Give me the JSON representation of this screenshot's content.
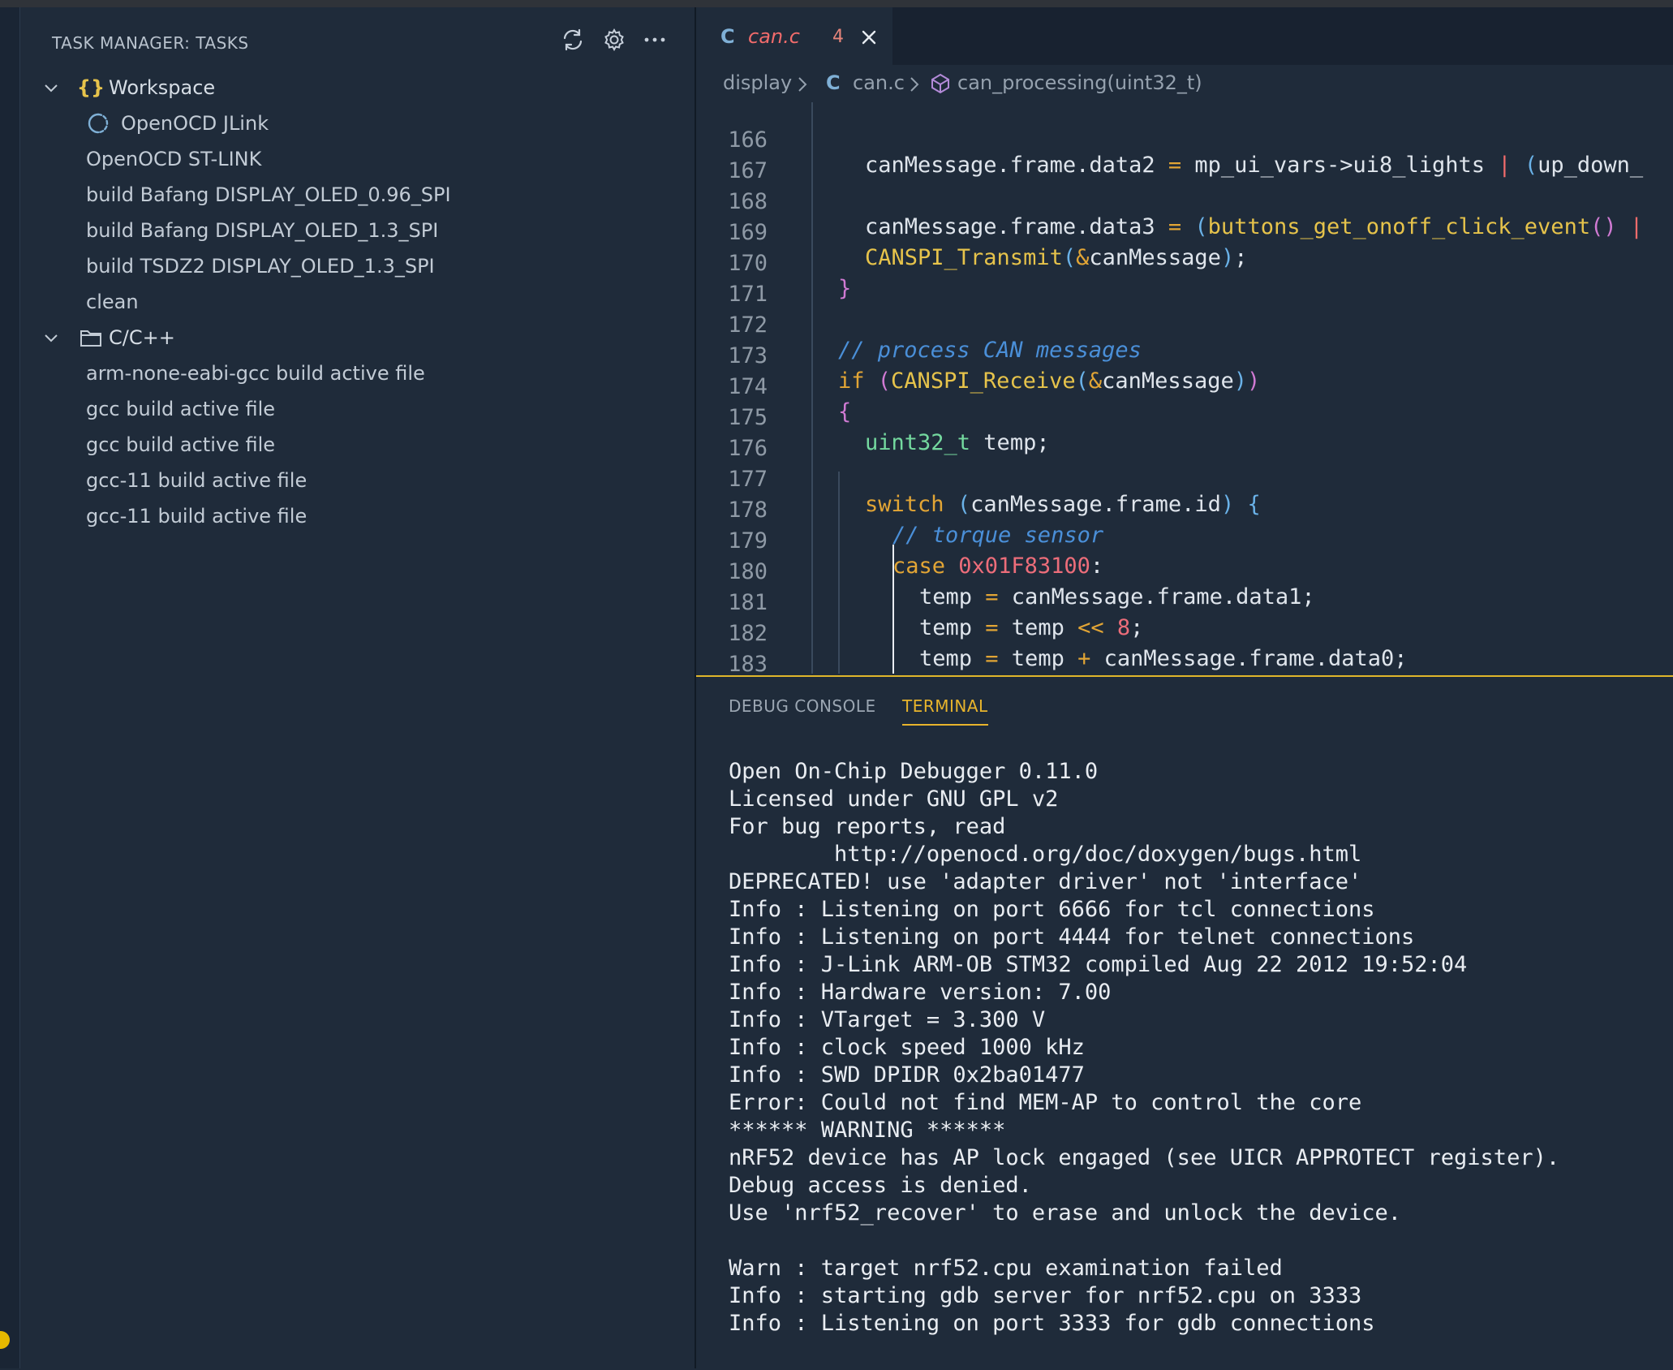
{
  "sidebar": {
    "title": "TASK MANAGER: TASKS",
    "groups": [
      {
        "label": "Workspace",
        "icon": "braces-icon",
        "tasks": [
          "OpenOCD JLink",
          "OpenOCD ST-LINK",
          "build Bafang DISPLAY_OLED_0.96_SPI",
          "build Bafang DISPLAY_OLED_1.3_SPI",
          "build TSDZ2 DISPLAY_OLED_1.3_SPI",
          "clean"
        ]
      },
      {
        "label": "C/C++",
        "icon": "folder-icon",
        "tasks": [
          "arm-none-eabi-gcc build active file",
          "gcc build active file",
          "gcc build active file",
          "gcc-11 build active file",
          "gcc-11 build active file"
        ]
      }
    ]
  },
  "editor": {
    "tab": {
      "icon_letter": "C",
      "name": "can.c",
      "problems": "4"
    },
    "breadcrumb": [
      "display",
      "can.c",
      "can_processing(uint32_t)"
    ],
    "line_numbers": [
      "166",
      "167",
      "168",
      "169",
      "170",
      "171",
      "172",
      "173",
      "174",
      "175",
      "176",
      "177",
      "178",
      "179",
      "180",
      "181",
      "182",
      "183"
    ]
  },
  "panel": {
    "tabs": [
      "DEBUG CONSOLE",
      "TERMINAL"
    ],
    "active_tab": "TERMINAL",
    "terminal_lines": [
      "Open On-Chip Debugger 0.11.0",
      "Licensed under GNU GPL v2",
      "For bug reports, read",
      "        http://openocd.org/doc/doxygen/bugs.html",
      "DEPRECATED! use 'adapter driver' not 'interface'",
      "Info : Listening on port 6666 for tcl connections",
      "Info : Listening on port 4444 for telnet connections",
      "Info : J-Link ARM-OB STM32 compiled Aug 22 2012 19:52:04",
      "Info : Hardware version: 7.00",
      "Info : VTarget = 3.300 V",
      "Info : clock speed 1000 kHz",
      "Info : SWD DPIDR 0x2ba01477",
      "Error: Could not find MEM-AP to control the core",
      "****** WARNING ******",
      "nRF52 device has AP lock engaged (see UICR APPROTECT register).",
      "Debug access is denied.",
      "Use 'nrf52_recover' to erase and unlock the device.",
      "",
      "Warn : target nrf52.cpu examination failed",
      "Info : starting gdb server for nrf52.cpu on 3333",
      "Info : Listening on port 3333 for gdb connections"
    ]
  },
  "colors": {
    "background": "#1f2b3a",
    "accent": "#e8b42c",
    "error": "#f06b6b"
  }
}
